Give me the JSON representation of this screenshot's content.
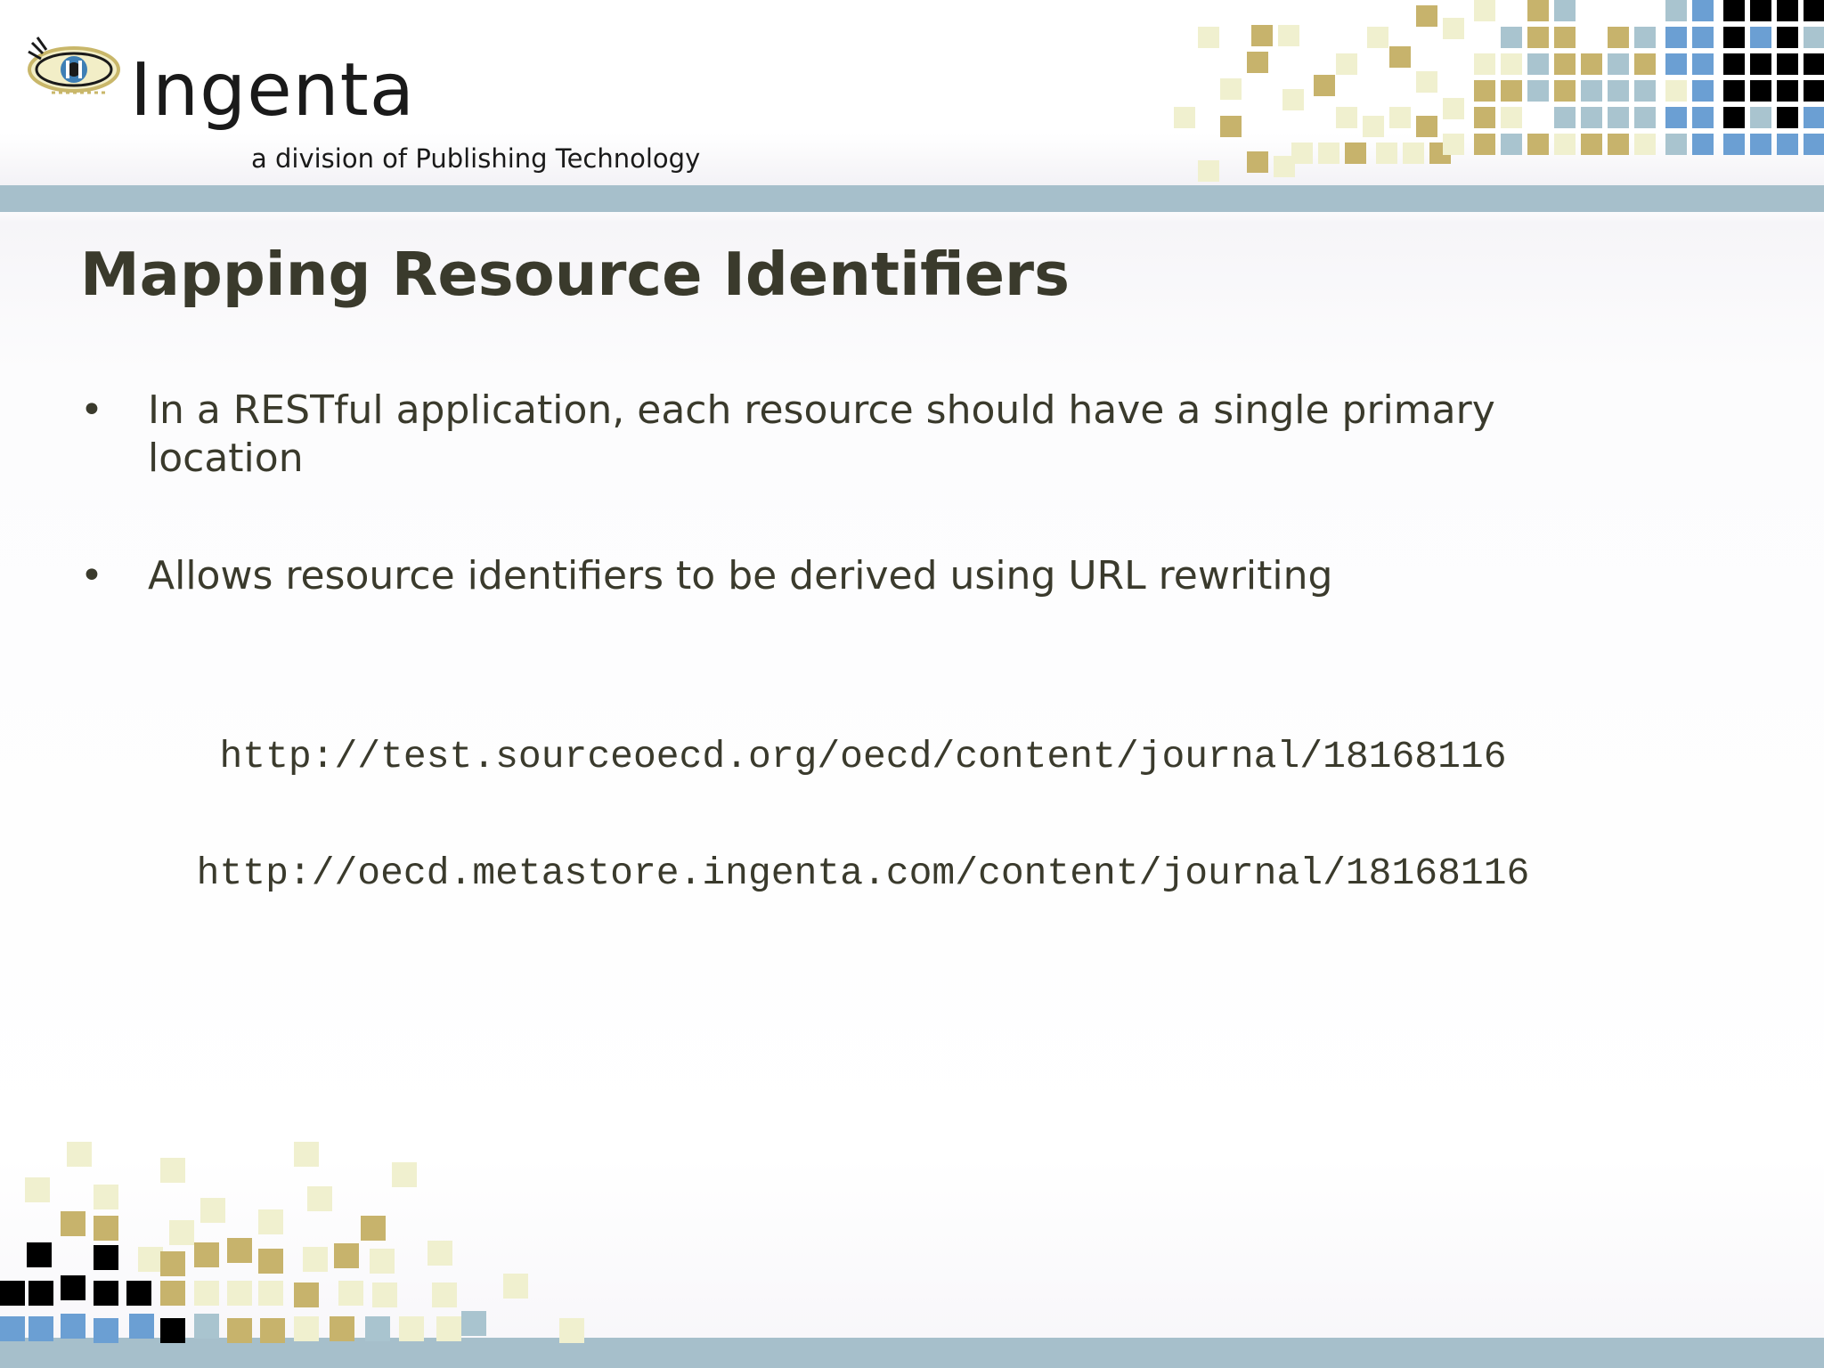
{
  "brand": {
    "logo_name": "Ingenta",
    "subtitle": "a division of Publishing Technology",
    "colors": {
      "band": "#a6bfcb",
      "title_text": "#3a3a2c",
      "mosaic_gold": "#c7b36c",
      "mosaic_pale": "#f0f0cf",
      "mosaic_blue": "#6b9fd3",
      "mosaic_lightblue": "#a9c4cf",
      "mosaic_black": "#000000"
    },
    "icons": [
      "eye-logo-icon"
    ]
  },
  "slide": {
    "title": "Mapping Resource Identifiers",
    "bullet_char": "•",
    "bullets": [
      {
        "text": "In a RESTful application, each resource should have a single primary location"
      },
      {
        "text": "Allows resource identifiers to be derived using URL rewriting"
      }
    ],
    "urls": [
      "http://test.sourceoecd.org/oecd/content/journal/18168116",
      "http://oecd.metastore.ingenta.com/content/journal/18168116"
    ]
  }
}
